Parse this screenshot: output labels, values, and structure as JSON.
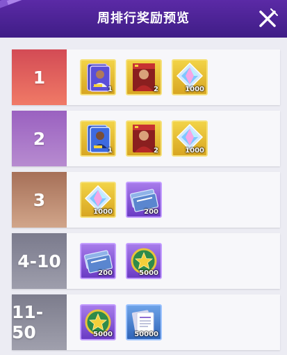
{
  "header": {
    "title": "周排行奖励预览"
  },
  "rows": [
    {
      "rank": "1",
      "items": [
        {
          "icon": "player-card-pack-icon",
          "qty": "1"
        },
        {
          "icon": "player-card-icon",
          "qty": "2"
        },
        {
          "icon": "diamond-gem-icon",
          "qty": "1000"
        }
      ]
    },
    {
      "rank": "2",
      "items": [
        {
          "icon": "player-card-pack-icon",
          "qty": "1"
        },
        {
          "icon": "player-card-icon",
          "qty": "2"
        },
        {
          "icon": "diamond-gem-icon",
          "qty": "1000"
        }
      ]
    },
    {
      "rank": "3",
      "items": [
        {
          "icon": "diamond-gem-icon",
          "qty": "1000"
        },
        {
          "icon": "tickets-icon",
          "qty": "200"
        }
      ]
    },
    {
      "rank": "4-10",
      "items": [
        {
          "icon": "tickets-icon",
          "qty": "200"
        },
        {
          "icon": "star-coin-icon",
          "qty": "5000"
        }
      ]
    },
    {
      "rank": "11-50",
      "items": [
        {
          "icon": "star-coin-icon",
          "qty": "5000"
        },
        {
          "icon": "documents-icon",
          "qty": "50000"
        }
      ]
    }
  ],
  "colors": {
    "header": "#4a2296",
    "rank1": "#e6645f",
    "rank2": "#a577c4",
    "rank3": "#c08d70",
    "rank4_10": "#8e8e9e",
    "rank11_50": "#8a8a98"
  }
}
